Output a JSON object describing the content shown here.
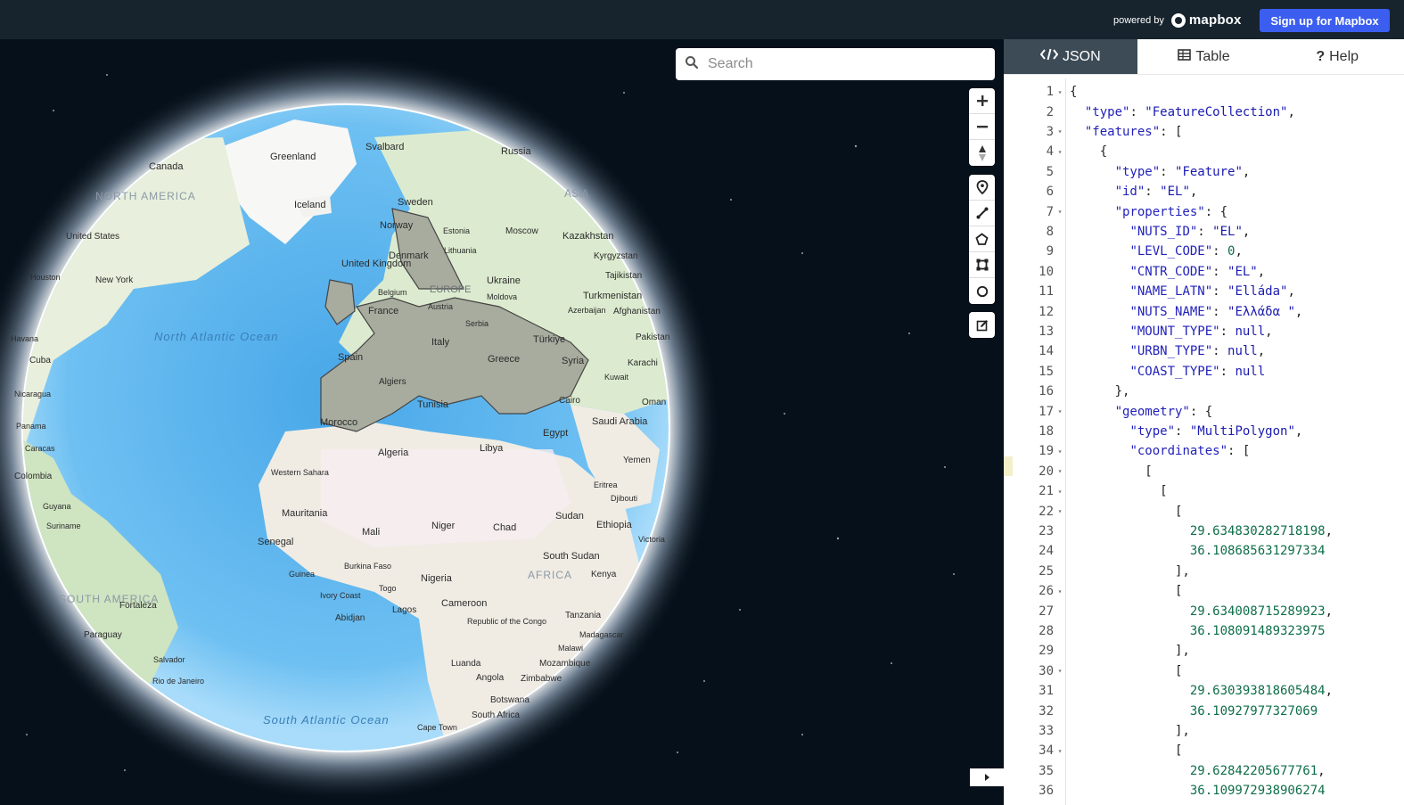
{
  "header": {
    "powered_by": "powered by",
    "brand": "mapbox",
    "signup_label": "Sign up for Mapbox"
  },
  "search": {
    "placeholder": "Search"
  },
  "map_labels": {
    "svalbard": "Svalbard",
    "russia": "Russia",
    "greenland": "Greenland",
    "canada": "Canada",
    "north_america": "NORTH AMERICA",
    "iceland": "Iceland",
    "sweden": "Sweden",
    "asia": "ASIA",
    "norway": "Norway",
    "estonia": "Estonia",
    "moscow": "Moscow",
    "kazakhstan": "Kazakhstan",
    "united_states": "United States",
    "lithuania": "Lithuania",
    "denmark": "Denmark",
    "kyrgyzstan": "Kyrgyzstan",
    "uk": "United Kingdom",
    "tajikistan": "Tajikistan",
    "houston": "Houston",
    "new_york": "New York",
    "ukraine": "Ukraine",
    "belgium": "Belgium",
    "moldova": "Moldova",
    "turkmenistan": "Turkmenistan",
    "europe": "EUROPE",
    "austria": "Austria",
    "france": "France",
    "azerbaijan": "Azerbaijan",
    "afghanistan": "Afghanistan",
    "serbia": "Serbia",
    "north_atlantic": "North Atlantic Ocean",
    "havana": "Havana",
    "italy": "Italy",
    "turkiye": "Türkiye",
    "pakistan": "Pakistan",
    "cuba": "Cuba",
    "spain": "Spain",
    "greece": "Greece",
    "syria": "Syria",
    "karachi": "Karachi",
    "algiers": "Algiers",
    "kuwait": "Kuwait",
    "nicaragua": "Nicaragua",
    "tunisia": "Tunisia",
    "cairo": "Cairo",
    "oman": "Oman",
    "morocco": "Morocco",
    "saudi_arabia": "Saudi Arabia",
    "panama": "Panama",
    "egypt": "Egypt",
    "caracas": "Caracas",
    "algeria": "Algeria",
    "libya": "Libya",
    "yemen": "Yemen",
    "western_sahara": "Western Sahara",
    "colombia": "Colombia",
    "eritrea": "Eritrea",
    "djibouti": "Djibouti",
    "guyana": "Guyana",
    "mauritania": "Mauritania",
    "sudan": "Sudan",
    "suriname": "Suriname",
    "mali": "Mali",
    "niger": "Niger",
    "chad": "Chad",
    "ethiopia": "Ethiopia",
    "senegal": "Senegal",
    "victoria": "Victoria",
    "south_sudan": "South Sudan",
    "burkina_faso": "Burkina Faso",
    "africa": "AFRICA",
    "guinea": "Guinea",
    "nigeria": "Nigeria",
    "kenya": "Kenya",
    "togo": "Togo",
    "ivory_coast": "Ivory Coast",
    "south_america": "SOUTH AMERICA",
    "cameroon": "Cameroon",
    "fortaleza": "Fortaleza",
    "lagos": "Lagos",
    "abidjan": "Abidjan",
    "tanzania": "Tanzania",
    "congo": "Republic of the Congo",
    "paraguay": "Paraguay",
    "madagascar": "Madagascar",
    "malawi": "Malawi",
    "salvador": "Salvador",
    "luanda": "Luanda",
    "mozambique": "Mozambique",
    "angola": "Angola",
    "zimbabwe": "Zimbabwe",
    "rio": "Rio de Janeiro",
    "botswana": "Botswana",
    "south_africa": "South Africa",
    "south_atlantic": "South Atlantic Ocean",
    "cape_town": "Cape Town"
  },
  "tabs": [
    {
      "label": "JSON"
    },
    {
      "label": "Table"
    },
    {
      "label": "Help"
    }
  ],
  "editor": {
    "lines": [
      {
        "n": "1",
        "fold": true,
        "html": "{"
      },
      {
        "n": "2",
        "fold": false,
        "html": "  <span class=\"k\">\"type\"</span>: <span class=\"s\">\"FeatureCollection\"</span>,"
      },
      {
        "n": "3",
        "fold": true,
        "html": "  <span class=\"k\">\"features\"</span>: ["
      },
      {
        "n": "4",
        "fold": true,
        "html": "    {"
      },
      {
        "n": "5",
        "fold": false,
        "html": "      <span class=\"k\">\"type\"</span>: <span class=\"s\">\"Feature\"</span>,"
      },
      {
        "n": "6",
        "fold": false,
        "html": "      <span class=\"k\">\"id\"</span>: <span class=\"s\">\"EL\"</span>,"
      },
      {
        "n": "7",
        "fold": true,
        "html": "      <span class=\"k\">\"properties\"</span>: {"
      },
      {
        "n": "8",
        "fold": false,
        "html": "        <span class=\"k\">\"NUTS_ID\"</span>: <span class=\"s\">\"EL\"</span>,"
      },
      {
        "n": "9",
        "fold": false,
        "html": "        <span class=\"k\">\"LEVL_CODE\"</span>: <span class=\"n\">0</span>,"
      },
      {
        "n": "10",
        "fold": false,
        "html": "        <span class=\"k\">\"CNTR_CODE\"</span>: <span class=\"s\">\"EL\"</span>,"
      },
      {
        "n": "11",
        "fold": false,
        "html": "        <span class=\"k\">\"NAME_LATN\"</span>: <span class=\"s\">\"Elláda\"</span>,"
      },
      {
        "n": "12",
        "fold": false,
        "html": "        <span class=\"k\">\"NUTS_NAME\"</span>: <span class=\"s\">\"Ελλάδα \"</span>,"
      },
      {
        "n": "13",
        "fold": false,
        "html": "        <span class=\"k\">\"MOUNT_TYPE\"</span>: <span class=\"lit\">null</span>,"
      },
      {
        "n": "14",
        "fold": false,
        "html": "        <span class=\"k\">\"URBN_TYPE\"</span>: <span class=\"lit\">null</span>,"
      },
      {
        "n": "15",
        "fold": false,
        "html": "        <span class=\"k\">\"COAST_TYPE\"</span>: <span class=\"lit\">null</span>"
      },
      {
        "n": "16",
        "fold": false,
        "html": "      },"
      },
      {
        "n": "17",
        "fold": true,
        "html": "      <span class=\"k\">\"geometry\"</span>: {"
      },
      {
        "n": "18",
        "fold": false,
        "html": "        <span class=\"k\">\"type\"</span>: <span class=\"s\">\"MultiPolygon\"</span>,"
      },
      {
        "n": "19",
        "fold": true,
        "html": "        <span class=\"k\">\"coordinates\"</span>: ["
      },
      {
        "n": "20",
        "fold": true,
        "html": "          ["
      },
      {
        "n": "21",
        "fold": true,
        "html": "            ["
      },
      {
        "n": "22",
        "fold": true,
        "html": "              ["
      },
      {
        "n": "23",
        "fold": false,
        "html": "                <span class=\"n\">29.634830282718198</span>,"
      },
      {
        "n": "24",
        "fold": false,
        "html": "                <span class=\"n\">36.108685631297334</span>"
      },
      {
        "n": "25",
        "fold": false,
        "html": "              ],"
      },
      {
        "n": "26",
        "fold": true,
        "html": "              ["
      },
      {
        "n": "27",
        "fold": false,
        "html": "                <span class=\"n\">29.634008715289923</span>,"
      },
      {
        "n": "28",
        "fold": false,
        "html": "                <span class=\"n\">36.108091489323975</span>"
      },
      {
        "n": "29",
        "fold": false,
        "html": "              ],"
      },
      {
        "n": "30",
        "fold": true,
        "html": "              ["
      },
      {
        "n": "31",
        "fold": false,
        "html": "                <span class=\"n\">29.630393818605484</span>,"
      },
      {
        "n": "32",
        "fold": false,
        "html": "                <span class=\"n\">36.10927977327069</span>"
      },
      {
        "n": "33",
        "fold": false,
        "html": "              ],"
      },
      {
        "n": "34",
        "fold": true,
        "html": "              ["
      },
      {
        "n": "35",
        "fold": false,
        "html": "                <span class=\"n\">29.62842205677761</span>,"
      },
      {
        "n": "36",
        "fold": false,
        "html": "                <span class=\"n\">36.109972938906274</span>"
      }
    ]
  },
  "colors": {
    "accent": "#3b5ef0",
    "topbar": "#17242d",
    "active_tab": "#3c4b56"
  }
}
